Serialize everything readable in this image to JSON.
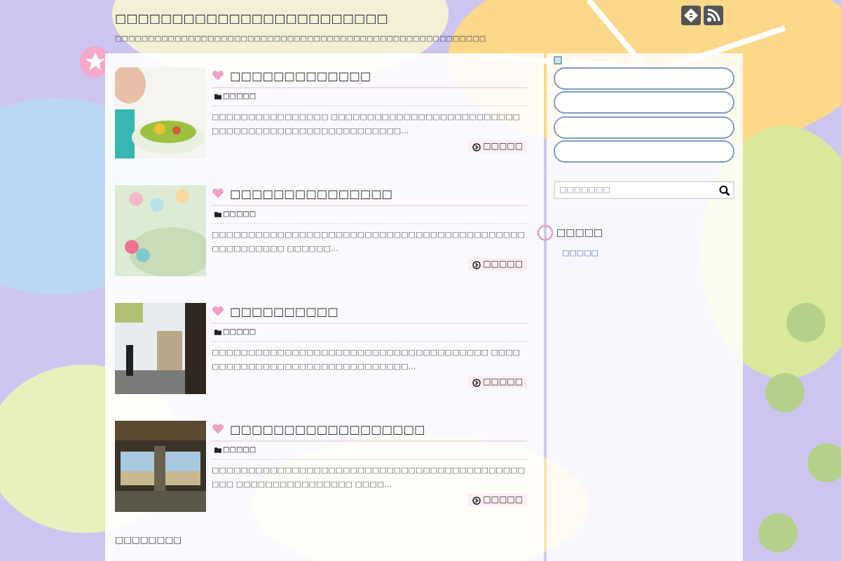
{
  "site": {
    "title": "□□□□□□□□□□□□□□□□□□□□□□□□",
    "tagline": "□□□□□□□□□□□□□□□□□□□□□□□□□□□□□□□□□□□□□□□□□□□□□□□□□□□□□□□□"
  },
  "posts": [
    {
      "title": "□□□□□□□□□□□□□",
      "category": "□□□□□",
      "excerpt": "□□□□□□□□□□□□□□□□ □□□□□□□□□□□□□□□□□□□□□□□□□□□□□□□□□□□□□□□□□□□□□□□□□□□□…",
      "more": "□□□□□"
    },
    {
      "title": "□□□□□□□□□□□□□□□",
      "category": "□□□□□",
      "excerpt": "□□□□□□□□□□□□□□□□□□□□□□□□□□□□□□□□□□□□□□□□□□□□□□□□□□□□□ □□□□□□…",
      "more": "□□□□□"
    },
    {
      "title": "□□□□□□□□□□",
      "category": "□□□□□",
      "excerpt": "□□□□□□□□□□□□□□□□□□□□□□□□□□□□□□□□□□□□□□ □□□□□□□□□□□□□□□□□□□□□□□□□□□□□□□…",
      "more": "□□□□□"
    },
    {
      "title": "□□□□□□□□□□□□□□□□□□",
      "category": "□□□□□",
      "excerpt": "□□□□□□□□□□□□□□□□□□□□□□□□□□□□□□□□□□□□□□□□□□□□□□ □□□□□□□□□□□□□□□□ □□□□…",
      "more": "□□□□□"
    }
  ],
  "pagination": "□□□□□□□□",
  "sidebar": {
    "search": {
      "placeholder": "□□□□□□□"
    },
    "widget": {
      "title": "□□□□□",
      "link": "□□□□□"
    }
  }
}
